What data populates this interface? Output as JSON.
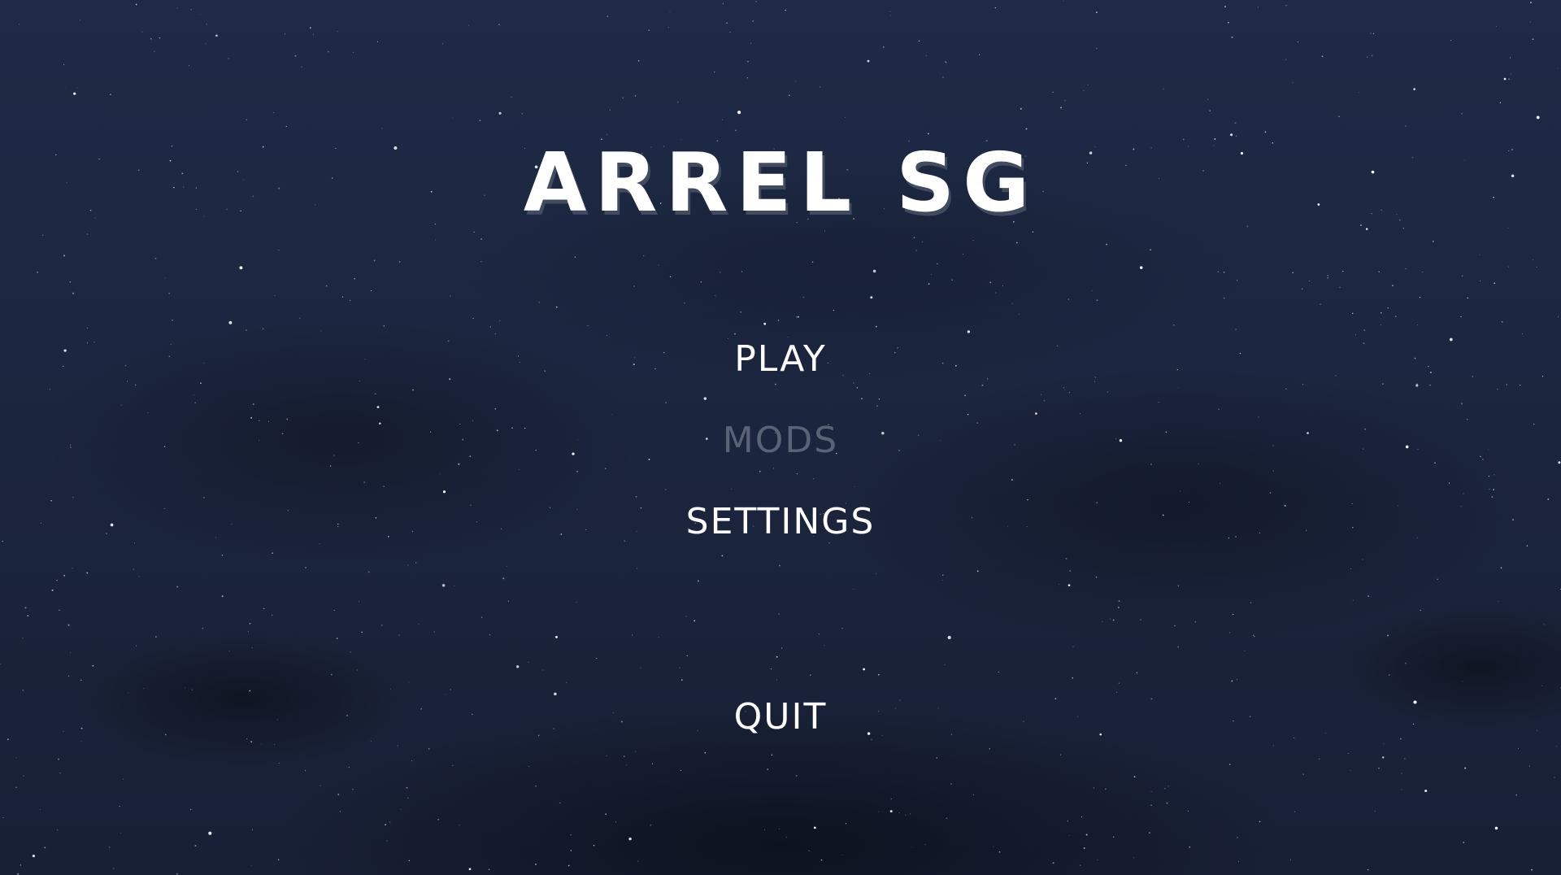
{
  "game": {
    "title": "ARREL SG"
  },
  "menu": {
    "items": [
      {
        "label": "PLAY",
        "enabled": true
      },
      {
        "label": "MODS",
        "enabled": false
      },
      {
        "label": "SETTINGS",
        "enabled": true
      },
      {
        "label": "QUIT",
        "enabled": true
      }
    ]
  },
  "colors": {
    "text": "#ffffff",
    "disabled_text": "#5a6276",
    "sky": "#1c2640"
  }
}
